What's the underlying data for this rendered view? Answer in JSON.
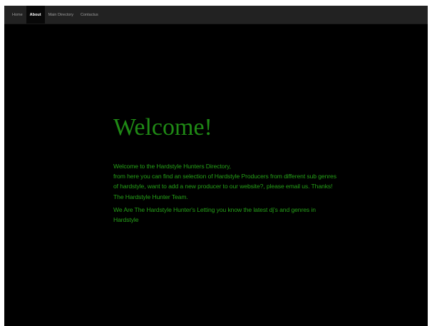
{
  "nav": {
    "items": [
      {
        "label": "Home"
      },
      {
        "label": "About"
      },
      {
        "label": "Main Directory"
      },
      {
        "label": "Contactus"
      }
    ],
    "active": "About"
  },
  "main": {
    "heading": "Welcome!",
    "paragraph1_lines": [
      "Welcome to the Hardstyle Hunters Directory,",
      "from here you can find an selection of Hardstyle Producers from different sub genres",
      "of hardstyle, want to add a new producer to our website?, please email us. Thanks!",
      "The Hardstyle Hunter Team."
    ],
    "paragraph2_lines": [
      "We Are The Hardstyle Hunter's Letting you know the latest dj's and genres in",
      "Hardstyle"
    ]
  },
  "colors": {
    "page_background": "#000000",
    "navbar_background": "#222222",
    "nav_text": "#9d9d9d",
    "nav_active_text": "#ffffff",
    "heading_color": "#1f8a15",
    "body_text_color": "#25a018"
  }
}
